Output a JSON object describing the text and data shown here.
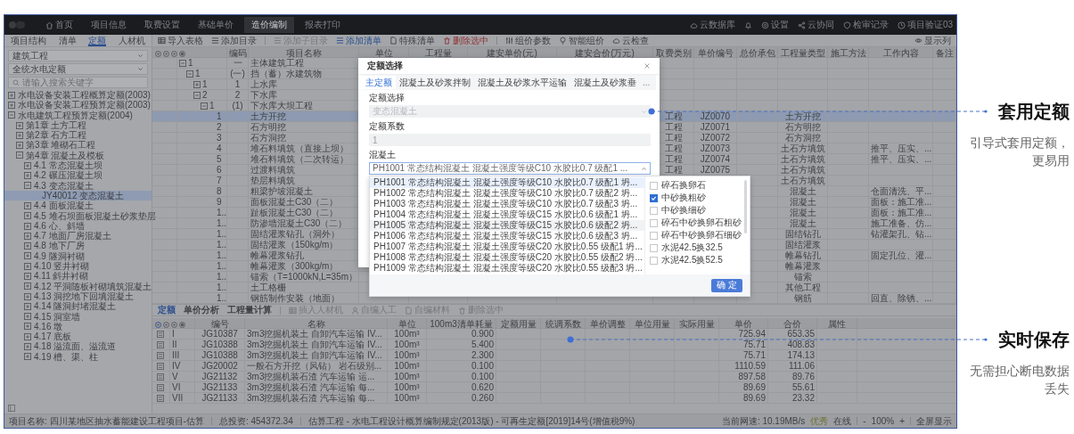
{
  "app": {
    "menu": [
      {
        "label": "首页",
        "selected": false
      },
      {
        "label": "项目信息",
        "selected": false
      },
      {
        "label": "取费设置",
        "selected": false
      },
      {
        "label": "基础单价",
        "selected": false
      },
      {
        "label": "造价编制",
        "selected": true
      },
      {
        "label": "报表打印",
        "selected": false
      }
    ],
    "top_actions": [
      "云数据库",
      "设置",
      "云协同",
      "检审记录",
      "项目验证03"
    ],
    "left_tabs": [
      {
        "label": "项目结构",
        "selected": false
      },
      {
        "label": "清单",
        "selected": false
      },
      {
        "label": "定额",
        "selected": true
      },
      {
        "label": "人材机",
        "selected": false
      }
    ],
    "toolbar": [
      {
        "label": "导入表格",
        "kind": "normal",
        "disabled": false
      },
      {
        "label": "添加目录",
        "kind": "normal",
        "disabled": false
      },
      {
        "label": "添加子目录",
        "kind": "normal",
        "disabled": true
      },
      {
        "label": "添加清单",
        "kind": "primary",
        "disabled": false
      },
      {
        "label": "特殊清单",
        "kind": "normal",
        "disabled": false
      },
      {
        "label": "删除选中",
        "kind": "danger",
        "disabled": false
      },
      {
        "label": "组价参数",
        "kind": "normal",
        "disabled": false
      },
      {
        "label": "智能组价",
        "kind": "normal",
        "disabled": false
      },
      {
        "label": "云检查",
        "kind": "normal",
        "disabled": false
      }
    ],
    "show_columns": "显示列",
    "left_panel": {
      "selects": [
        "建筑工程",
        "全统水电定额"
      ],
      "search": {
        "placeholder": "请输入搜索关键字"
      },
      "tree": [
        {
          "label": "水电设备安装工程概算定额(2003)",
          "expanded": false,
          "selected": false
        },
        {
          "label": "水电设备安装工程预算定额(2003)",
          "expanded": false,
          "selected": false
        },
        {
          "label": "水电建筑工程预算定额(2004)",
          "expanded": true,
          "selected": false,
          "children": [
            {
              "label": "第1章 土方工程",
              "expanded": false,
              "selected": false
            },
            {
              "label": "第2章 石方工程",
              "expanded": false,
              "selected": false
            },
            {
              "label": "第3章 堆砌石工程",
              "expanded": false,
              "selected": false
            },
            {
              "label": "第4章 混凝土及模板",
              "expanded": true,
              "selected": false,
              "children": [
                {
                  "label": "4.1 常态混凝土坝",
                  "expanded": false,
                  "selected": false
                },
                {
                  "label": "4.2 碾压混凝土坝",
                  "expanded": false,
                  "selected": false
                },
                {
                  "label": "4.3 变态混凝土",
                  "expanded": true,
                  "selected": false,
                  "children": [
                    {
                      "label": "JY40012 变态混凝土",
                      "selected": true
                    }
                  ]
                },
                {
                  "label": "4.4 面板混凝土",
                  "expanded": false,
                  "selected": false
                },
                {
                  "label": "4.5 堆石坝面板混凝土砂浆垫层",
                  "expanded": false,
                  "selected": false
                },
                {
                  "label": "4.6 心、斜墙",
                  "expanded": false,
                  "selected": false
                },
                {
                  "label": "4.7 地面厂房混凝土",
                  "expanded": false,
                  "selected": false
                },
                {
                  "label": "4.8 地下厂房",
                  "expanded": false,
                  "selected": false
                },
                {
                  "label": "4.9 隧洞衬砌",
                  "expanded": false,
                  "selected": false
                },
                {
                  "label": "4.10 竖井衬砌",
                  "expanded": false,
                  "selected": false
                },
                {
                  "label": "4.11 斜井衬砌",
                  "expanded": false,
                  "selected": false
                },
                {
                  "label": "4.12 平洞随板衬砌填筑混凝土",
                  "expanded": false,
                  "selected": false
                },
                {
                  "label": "4.13 洞挖地下回填混凝土",
                  "expanded": false,
                  "selected": false
                },
                {
                  "label": "4.14 隧洞封堵混凝土",
                  "expanded": false,
                  "selected": false
                },
                {
                  "label": "4.15 洞室墙",
                  "expanded": false,
                  "selected": false
                },
                {
                  "label": "4.16 墩",
                  "expanded": false,
                  "selected": false
                },
                {
                  "label": "4.17 底板",
                  "expanded": false,
                  "selected": false
                },
                {
                  "label": "4.18 溢流面、溢流道",
                  "expanded": false,
                  "selected": false
                },
                {
                  "label": "4.19 槽、渠、柱",
                  "expanded": false,
                  "selected": false
                }
              ]
            }
          ]
        }
      ]
    },
    "main_table": {
      "columns": [
        "编码",
        "项目名称",
        "单位",
        "工程量",
        "建安单价(元)",
        "建安合价(万元)",
        "取费类别",
        "单价编号",
        "总价承包",
        "工程量类型",
        "施工方法",
        "工作内容",
        "备注"
      ],
      "rows": [
        {
          "no": "1",
          "code": "一",
          "name": "主体建筑工程",
          "expanded": true,
          "selected": false,
          "children": [
            {
              "no": "1",
              "code": "(一)",
              "name": "挡（蓄）水建筑物",
              "expanded": true,
              "selected": false,
              "children": [
                {
                  "no": "1",
                  "code": "1",
                  "name": "上水库",
                  "expanded": false,
                  "selected": false
                },
                {
                  "no": "2",
                  "code": "2",
                  "name": "下水库",
                  "expanded": true,
                  "selected": false,
                  "children": [
                    {
                      "no": "1",
                      "code": "(1)",
                      "name": "下水库大坝工程",
                      "expanded": true,
                      "selected": false,
                      "children": [
                        {
                          "no": "1",
                          "name": "土方开挖",
                          "fee": "工程",
                          "price_code": "JZ0070",
                          "qty_type": "土方开挖",
                          "selected": true
                        },
                        {
                          "no": "2",
                          "name": "石方明挖",
                          "fee": "工程",
                          "price_code": "JZ0071",
                          "qty_type": "石方明挖",
                          "selected": false
                        },
                        {
                          "no": "3",
                          "name": "石方洞挖",
                          "fee": "工程",
                          "price_code": "JZ0072",
                          "qty_type": "石方洞挖",
                          "selected": false
                        },
                        {
                          "no": "4",
                          "name": "堆石料填筑（直接上坝）",
                          "fee": "工程",
                          "price_code": "JZ0073",
                          "qty_type": "土石方填筑",
                          "work": "推平、压实、...",
                          "selected": false
                        },
                        {
                          "no": "5",
                          "name": "堆石料填筑（二次转运）",
                          "fee": "工程",
                          "price_code": "JZ0074",
                          "qty_type": "土石方填筑",
                          "work": "推平、压实、...",
                          "selected": false
                        },
                        {
                          "no": "6",
                          "name": "过渡料填筑",
                          "fee": "工程",
                          "price_code": "JZ0075",
                          "qty_type": "土石方填筑",
                          "selected": false
                        },
                        {
                          "no": "7",
                          "name": "垫层料填筑",
                          "qty_type": "土石方填筑",
                          "selected": false
                        },
                        {
                          "no": "8",
                          "name": "粗梁护坡混凝土",
                          "qty_type": "混凝土",
                          "work": "仓面清洗、平...",
                          "selected": false
                        },
                        {
                          "no": "9",
                          "name": "面板混凝土C30（二）",
                          "qty_type": "混凝土",
                          "work": "面板：施工准...",
                          "selected": false
                        },
                        {
                          "no": "1..",
                          "name": "趾板混凝土C30（二）",
                          "qty_type": "混凝土",
                          "work": "面板：施工准...",
                          "selected": false
                        },
                        {
                          "no": "1..",
                          "name": "防渗墙混凝土C30（二）",
                          "qty_type": "混凝土",
                          "work": "施工准备、仿...",
                          "selected": false
                        },
                        {
                          "no": "1..",
                          "name": "固结灌浆钻孔（洞外）",
                          "qty_type": "固结钻孔",
                          "work": "钻灌架孔、钻...",
                          "selected": false
                        },
                        {
                          "no": "1..",
                          "name": "固结灌浆（150kg/m）",
                          "qty_type": "固结灌浆",
                          "selected": false
                        },
                        {
                          "no": "1..",
                          "name": "帷幕灌浆钻孔",
                          "qty_type": "帷幕钻孔",
                          "work": "固定孔位、灌...",
                          "selected": false
                        },
                        {
                          "no": "1..",
                          "name": "帷幕灌浆（300kg/m）",
                          "qty_type": "帷幕灌浆",
                          "selected": false
                        },
                        {
                          "no": "1..",
                          "name": "锚索（T=1000kN,L=35m）",
                          "qty_type": "锚索",
                          "selected": false
                        },
                        {
                          "no": "1..",
                          "name": "土工格栅",
                          "qty_type": "其他工程",
                          "selected": false
                        },
                        {
                          "no": "1..",
                          "name": "钢筋制作安装（地面）",
                          "qty_type": "钢筋",
                          "work": "回直、除锈、...",
                          "selected": false
                        }
                      ]
                    }
                  ]
                }
              ]
            }
          ]
        }
      ]
    },
    "detail": {
      "tabs": [
        {
          "label": "定额",
          "selected": true
        },
        {
          "label": "单价分析",
          "selected": false
        },
        {
          "label": "工程量计算",
          "selected": false
        }
      ],
      "actions": [
        {
          "label": "插入人材机",
          "disabled": true
        },
        {
          "label": "自编人工",
          "disabled": true
        },
        {
          "label": "自编材料",
          "disabled": true
        },
        {
          "label": "删除选中",
          "disabled": true
        }
      ],
      "columns": [
        "编号",
        "名称",
        "单位",
        "100m3清单耗量",
        "定额用量",
        "统调系数",
        "单价调整",
        "单位用量",
        "实际用量",
        "单价",
        "合价",
        "属性"
      ],
      "rows": [
        {
          "no": "I",
          "code": "JG10387",
          "name": "3m3挖掘机装土 自卸汽车运输 IV...",
          "unit": "100m³",
          "qty": "0.900",
          "price": "725.94",
          "total": "653.35"
        },
        {
          "no": "II",
          "code": "JG10388",
          "name": "3m3挖掘机装土 自卸汽车运输 IV...",
          "unit": "100m³",
          "qty": "5.400",
          "price": "75.71",
          "total": "408.83"
        },
        {
          "no": "III",
          "code": "JG10388",
          "name": "3m3挖掘机装土 自卸汽车运输 IV...",
          "unit": "100m³",
          "qty": "2.300",
          "price": "75.71",
          "total": "174.13"
        },
        {
          "no": "IV",
          "code": "JG20002",
          "name": "一般石方开挖（风钻） 岩石级别...",
          "unit": "100m³",
          "qty": "0.100",
          "price": "1110.59",
          "total": "111.06"
        },
        {
          "no": "V",
          "code": "JG21132",
          "name": "3m3挖掘机装石渣 汽车运输 运...",
          "unit": "100m³",
          "qty": "0.100",
          "price": "897.58",
          "total": "89.76"
        },
        {
          "no": "VI",
          "code": "JG21133",
          "name": "3m3挖掘机装石渣 汽车运输 每...",
          "unit": "100m³",
          "qty": "0.620",
          "price": "89.69",
          "total": "55.61"
        },
        {
          "no": "VII",
          "code": "JG21133",
          "name": "3m3挖掘机装石渣 汽车运输 每...",
          "unit": "100m³",
          "qty": "0.260",
          "price": "89.69",
          "total": "23.32"
        }
      ]
    },
    "dialog": {
      "title": "定额选择",
      "tabs": [
        {
          "label": "主定额",
          "selected": true
        },
        {
          "label": "混凝土及砂浆拌制",
          "selected": false
        },
        {
          "label": "混凝土及砂浆水平运输",
          "selected": false
        },
        {
          "label": "混凝土及砂浆垂",
          "selected": false
        }
      ],
      "more": "...",
      "fields": [
        {
          "label": "定额选择",
          "kind": "select",
          "value": "变态混凝土",
          "disabled": true,
          "expanded": false
        },
        {
          "label": "定额系数",
          "kind": "input",
          "value": "1",
          "disabled": true
        },
        {
          "label": "混凝土",
          "kind": "select",
          "value": "PH1001 常态结构混凝土 混凝土强度等级C10 水胶比0.7 级配1 ...",
          "disabled": false,
          "expanded": true
        }
      ],
      "options": [
        {
          "label": "PH1001 常态结构混凝土 混凝土强度等级C10 水胶比0.7 级配1 坍...",
          "selected": true,
          "hovered": false
        },
        {
          "label": "PH1002 常态结构混凝土 混凝土强度等级C10 水胶比0.7 级配2 坍...",
          "selected": false,
          "hovered": false
        },
        {
          "label": "PH1003 常态结构混凝土 混凝土强度等级C10 水胶比0.7 级配3 坍...",
          "selected": false,
          "hovered": false
        },
        {
          "label": "PH1004 常态结构混凝土 混凝土强度等级C15 水胶比0.6 级配1 坍...",
          "selected": false,
          "hovered": false
        },
        {
          "label": "PH1005 常态结构混凝土 混凝土强度等级C15 水胶比0.6 级配2 坍...",
          "selected": false,
          "hovered": true
        },
        {
          "label": "PH1006 常态结构混凝土 混凝土强度等级C15 水胶比0.6 级配3 坍...",
          "selected": false,
          "hovered": false
        },
        {
          "label": "PH1007 常态结构混凝土 混凝土强度等级C20 水胶比0.55 级配1 坍...",
          "selected": false,
          "hovered": false
        },
        {
          "label": "PH1008 常态结构混凝土 混凝土强度等级C20 水胶比0.55 级配2 坍...",
          "selected": false,
          "hovered": false
        },
        {
          "label": "PH1009 常态结构混凝土 混凝土强度等级C20 水胶比0.55 级配3 坍...",
          "selected": false,
          "hovered": false
        }
      ],
      "switches": [
        {
          "label": "碎石换卵石",
          "checked": false
        },
        {
          "label": "中砂换粗砂",
          "checked": true
        },
        {
          "label": "中砂换细砂",
          "checked": false
        },
        {
          "label": "碎石中砂换卵石粗砂",
          "checked": false
        },
        {
          "label": "碎石中砂换卵石细砂",
          "checked": false
        },
        {
          "label": "水泥42.5换32.5",
          "checked": false
        },
        {
          "label": "水泥42.5换52.5",
          "checked": false
        }
      ],
      "confirm": "确 定"
    },
    "status_bar": {
      "project": "项目名称: 四川某地区抽水蓄能建设工程项目-估算",
      "investment": "总投资: 454372.34",
      "standard": "估算工程 - 水电工程设计概算编制规定(2013版) - 可再生定额[2019]14号(增值税9%)",
      "speed": "当前网速: 10.19MB/s",
      "quality": "优秀",
      "connection": "在线",
      "zoom_out": "-",
      "zoom": "100%",
      "zoom_in": "+",
      "fullscreen": "全屏显示"
    }
  },
  "callouts": [
    {
      "title": "套用定额",
      "subtitle": "引导式套用定额，更易用"
    },
    {
      "title": "实时保存",
      "subtitle": "无需担心断电数据丢失"
    }
  ]
}
